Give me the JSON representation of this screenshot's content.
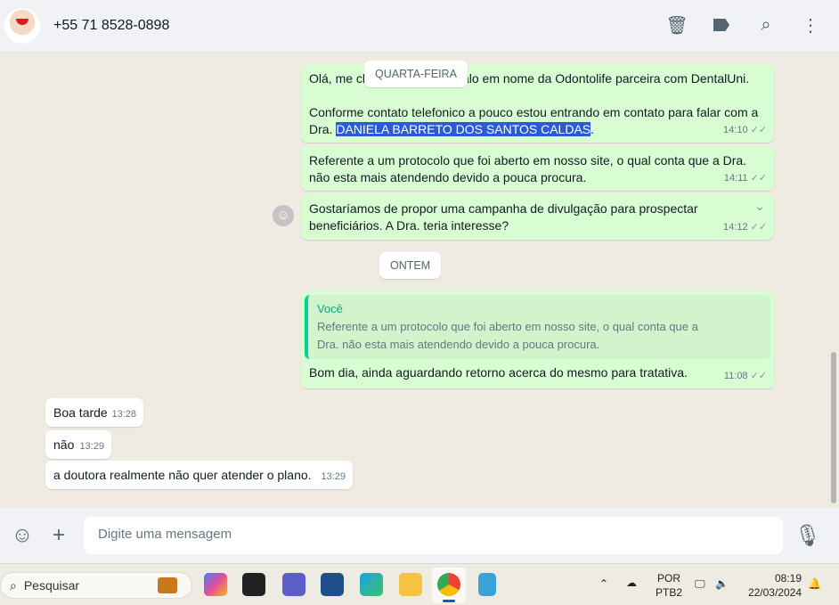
{
  "header": {
    "title": "+55 71 8528-0898",
    "icons": [
      "delete-icon",
      "label-icon",
      "search-icon",
      "menu-icon"
    ]
  },
  "chips": {
    "wednesday": "QUARTA-FEIRA",
    "yesterday": "ONTEM"
  },
  "messages": [
    {
      "line1_a": "Olá, me chamo Lizandra e falo em nome da Odontolife parceira com DentalUni.",
      "line2": "Conforme contato telefonico a pouco estou entrando em contato para falar com a Dra. ",
      "highlight": "DANIELA BARRETO DOS SANTOS CALDAS",
      "after": ".",
      "time": "14:10"
    },
    {
      "text": "Referente a um protocolo que foi aberto em nosso site, o qual conta que a Dra. não esta mais atendendo devido a pouca procura.",
      "time": "14:11"
    },
    {
      "text": "Gostaríamos de propor uma campanha de divulgação para prospectar beneficiários. A Dra. teria interesse?",
      "time": "14:12"
    },
    {
      "quote_author": "Você",
      "quote_text": "Referente a um protocolo que foi aberto em nosso site, o qual conta que a Dra. não esta mais atendendo devido a pouca procura.",
      "text": "Bom dia, ainda aguardando retorno acerca do mesmo para tratativa.",
      "time": "11:08"
    },
    {
      "text": "Boa tarde",
      "time": "13:28"
    },
    {
      "text": "não",
      "time": "13:29"
    },
    {
      "text": "a doutora realmente não quer atender o plano.",
      "time": "13:29"
    }
  ],
  "composer": {
    "placeholder": "Digite uma mensagem"
  },
  "taskbar": {
    "search": "Pesquisar",
    "lang1": "POR",
    "lang2": "PTB2",
    "time": "08:19",
    "date": "22/03/2024"
  }
}
